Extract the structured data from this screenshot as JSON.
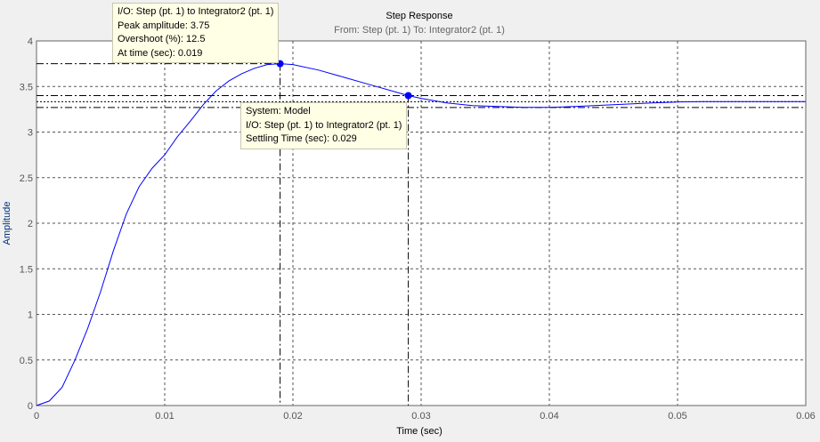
{
  "chart_data": {
    "type": "line",
    "title": "Step Response",
    "subtitle": "From: Step (pt. 1)  To: Integrator2 (pt. 1)",
    "xlabel": "Time (sec)",
    "ylabel": "Amplitude",
    "xlim": [
      0,
      0.06
    ],
    "ylim": [
      0,
      4
    ],
    "xticks": [
      "0",
      "0.01",
      "0.02",
      "0.03",
      "0.04",
      "0.05",
      "0.06"
    ],
    "yticks": [
      "0",
      "0.5",
      "1",
      "1.5",
      "2",
      "2.5",
      "3",
      "3.5",
      "4"
    ],
    "grid": true,
    "series": [
      {
        "name": "Model",
        "color": "#0000ff",
        "x": [
          0,
          0.001,
          0.002,
          0.003,
          0.004,
          0.005,
          0.006,
          0.007,
          0.008,
          0.009,
          0.01,
          0.011,
          0.012,
          0.013,
          0.014,
          0.015,
          0.016,
          0.017,
          0.018,
          0.019,
          0.02,
          0.022,
          0.024,
          0.026,
          0.028,
          0.029,
          0.03,
          0.032,
          0.034,
          0.036,
          0.038,
          0.04,
          0.042,
          0.045,
          0.048,
          0.05,
          0.052,
          0.055,
          0.06
        ],
        "y": [
          0,
          0.05,
          0.2,
          0.5,
          0.85,
          1.25,
          1.7,
          2.1,
          2.4,
          2.6,
          2.75,
          2.95,
          3.12,
          3.3,
          3.45,
          3.56,
          3.64,
          3.7,
          3.74,
          3.75,
          3.74,
          3.68,
          3.6,
          3.52,
          3.44,
          3.4,
          3.37,
          3.32,
          3.29,
          3.28,
          3.27,
          3.27,
          3.28,
          3.3,
          3.32,
          3.33,
          3.335,
          3.335,
          3.335
        ]
      }
    ],
    "settling_band": [
      3.27,
      3.333,
      3.4
    ],
    "annotations": [
      {
        "x": 0.019,
        "y": 3.75,
        "lines": [
          "I/O: Step (pt. 1) to Integrator2 (pt. 1)",
          "Peak amplitude: 3.75",
          "Overshoot (%): 12.5",
          "At time (sec): 0.019"
        ]
      },
      {
        "x": 0.029,
        "y": 3.4,
        "lines": [
          "System: Model",
          "I/O: Step (pt. 1) to Integrator2 (pt. 1)",
          "Settling Time (sec): 0.029"
        ]
      }
    ]
  }
}
